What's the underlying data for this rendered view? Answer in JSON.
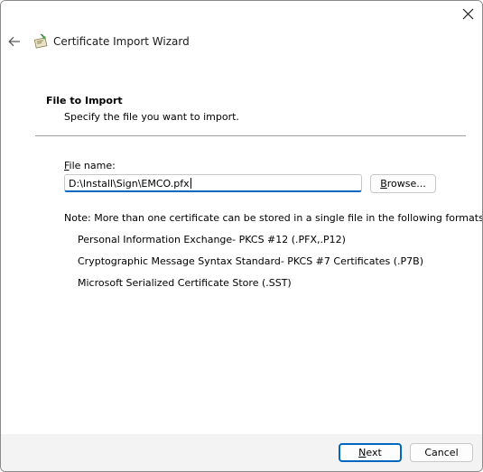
{
  "window": {
    "title": "Certificate Import Wizard",
    "close_icon": "close-icon",
    "back_icon": "arrow-left-icon",
    "app_icon": "certificate-icon"
  },
  "section": {
    "title": "File to Import",
    "description": "Specify the file you want to import."
  },
  "file": {
    "label_mnemonic": "F",
    "label_rest": "ile name:",
    "value": "D:\\Install\\Sign\\EMCO.pfx",
    "browse_mnemonic": "B",
    "browse_rest": "rowse..."
  },
  "note": {
    "text": "Note:  More than one certificate can be stored in a single file in the following formats:",
    "formats": [
      "Personal Information Exchange- PKCS #12 (.PFX,.P12)",
      "Cryptographic Message Syntax Standard- PKCS #7 Certificates (.P7B)",
      "Microsoft Serialized Certificate Store (.SST)"
    ]
  },
  "footer": {
    "next_mnemonic": "N",
    "next_rest": "ext",
    "cancel_label": "Cancel"
  },
  "colors": {
    "accent": "#0067c0",
    "footer_bg": "#f3f3f3"
  }
}
